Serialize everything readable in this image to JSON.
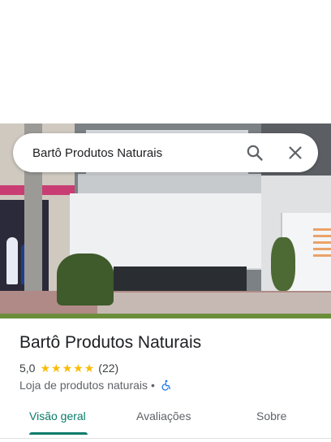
{
  "search": {
    "query": "Bartô Produtos Naturais"
  },
  "place": {
    "title": "Bartô Produtos Naturais",
    "rating": "5,0",
    "star_count": 5,
    "review_count": "(22)",
    "category": "Loja de produtos naturais",
    "separator": "•",
    "accessibility_icon": "wheelchair-icon"
  },
  "tabs": [
    {
      "label": "Visão geral",
      "active": true
    },
    {
      "label": "Avaliações",
      "active": false
    },
    {
      "label": "Sobre",
      "active": false
    }
  ],
  "colors": {
    "accent": "#0b7a6a",
    "star": "#fbbc04",
    "accessibility": "#1a73e8"
  },
  "icons": {
    "search": "search-icon",
    "close": "close-icon",
    "star": "star-icon"
  }
}
